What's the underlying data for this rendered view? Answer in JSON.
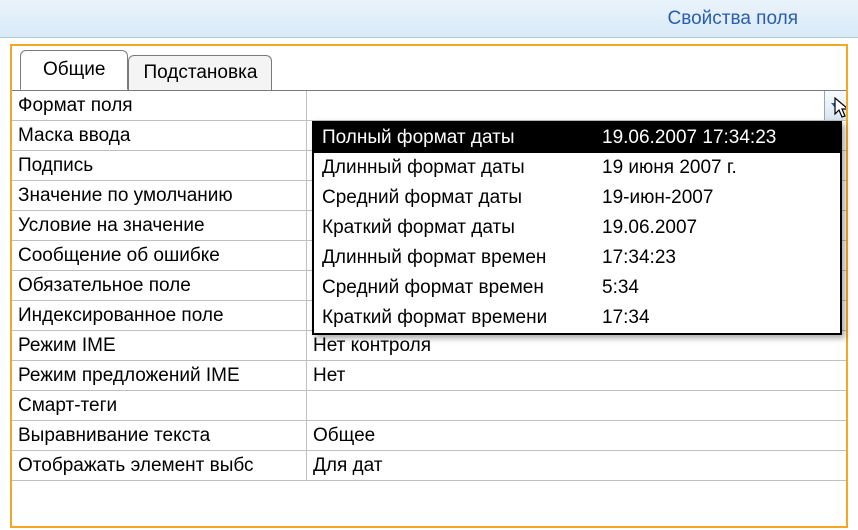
{
  "titlebar": {
    "title": "Свойства поля"
  },
  "tabs": {
    "general": "Общие",
    "lookup": "Подстановка"
  },
  "properties": [
    {
      "label": "Формат поля",
      "value": ""
    },
    {
      "label": "Маска ввода",
      "value": ""
    },
    {
      "label": "Подпись",
      "value": ""
    },
    {
      "label": "Значение по умолчанию",
      "value": ""
    },
    {
      "label": "Условие на значение",
      "value": ""
    },
    {
      "label": "Сообщение об ошибке",
      "value": ""
    },
    {
      "label": "Обязательное поле",
      "value": ""
    },
    {
      "label": "Индексированное поле",
      "value": ""
    },
    {
      "label": "Режим IME",
      "value": "Нет контроля"
    },
    {
      "label": "Режим предложений IME",
      "value": "Нет"
    },
    {
      "label": "Смарт-теги",
      "value": ""
    },
    {
      "label": "Выравнивание текста",
      "value": "Общее"
    },
    {
      "label": "Отображать элемент выбс",
      "value": "Для дат"
    }
  ],
  "dropdown": {
    "options": [
      {
        "name": "Полный формат даты",
        "example": "19.06.2007 17:34:23",
        "selected": true
      },
      {
        "name": "Длинный формат даты",
        "example": "19 июня 2007 г.",
        "selected": false
      },
      {
        "name": "Средний формат даты",
        "example": "19-июн-2007",
        "selected": false
      },
      {
        "name": "Краткий формат даты",
        "example": "19.06.2007",
        "selected": false
      },
      {
        "name": "Длинный формат времен",
        "example": "17:34:23",
        "selected": false
      },
      {
        "name": "Средний формат времен",
        "example": "5:34",
        "selected": false
      },
      {
        "name": "Краткий формат времени",
        "example": "17:34",
        "selected": false
      }
    ]
  }
}
